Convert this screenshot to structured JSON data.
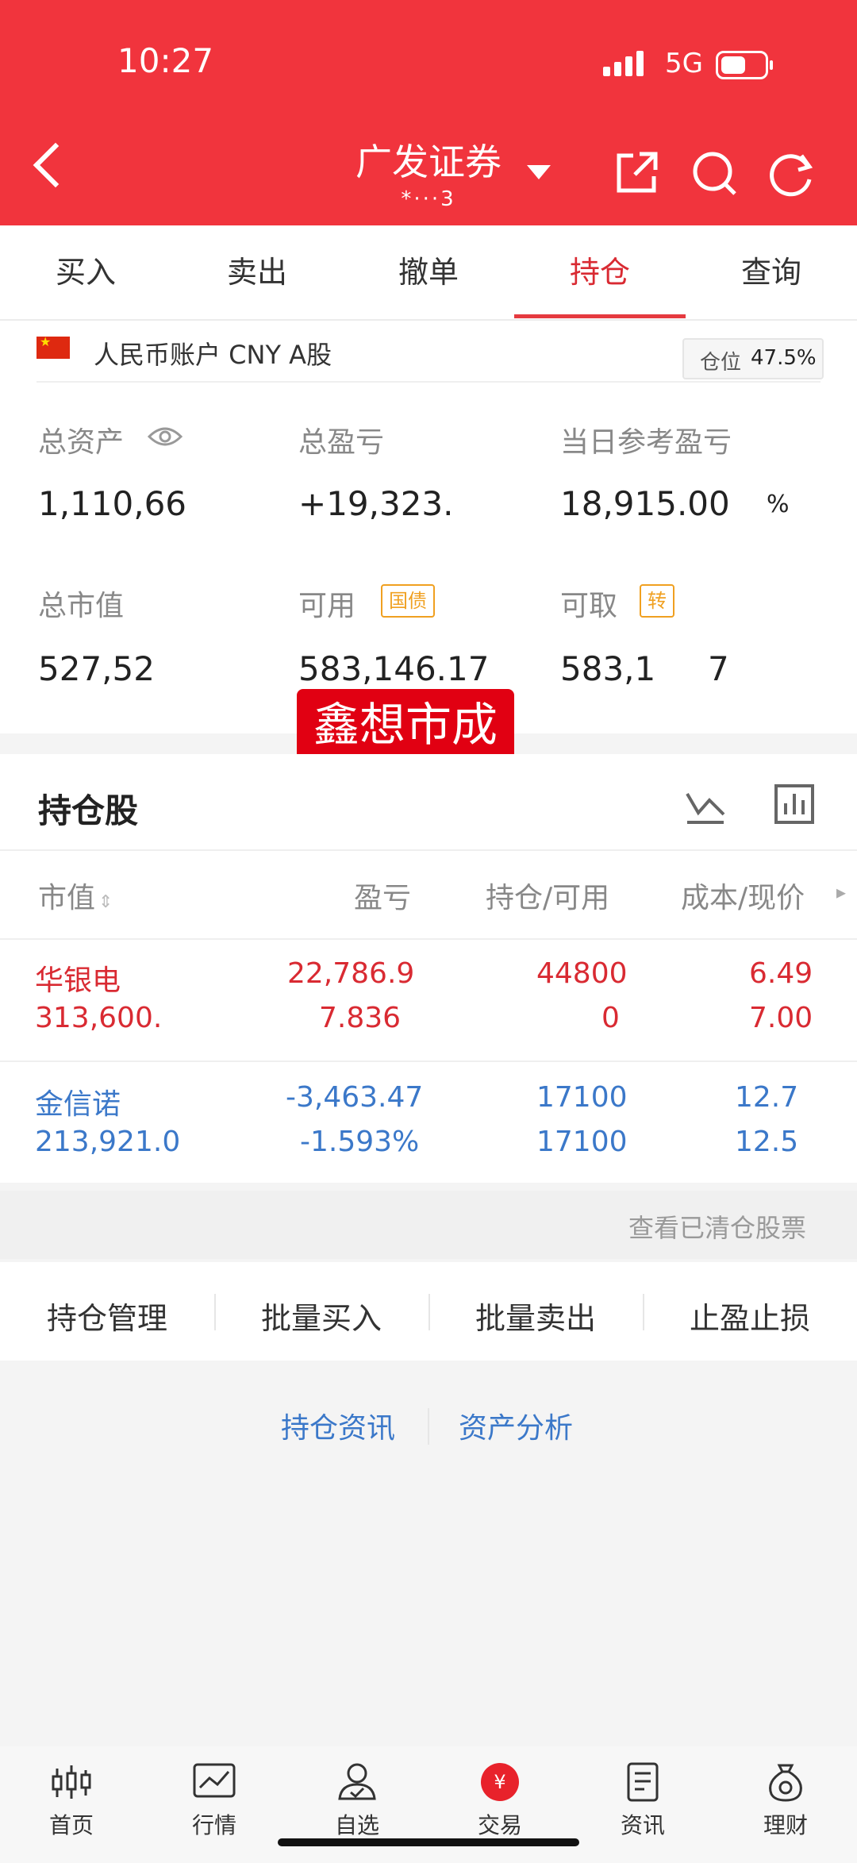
{
  "status_bar": {
    "time": "10:27",
    "network": "5G"
  },
  "header": {
    "account_name": "广发证券",
    "account_sub": "*···3"
  },
  "tabs": [
    {
      "label": "买入"
    },
    {
      "label": "卖出"
    },
    {
      "label": "撤单"
    },
    {
      "label": "持仓",
      "active": true
    },
    {
      "label": "查询"
    }
  ],
  "account": {
    "type_label": "人民币账户 CNY A股",
    "position_label": "仓位",
    "position_value": "47.5%",
    "position_ratio": 0.475
  },
  "metrics": {
    "total_assets_label": "总资产",
    "total_assets_value": "1,110,66",
    "total_pl_label": "总盈亏",
    "total_pl_value": "+19,323.",
    "daily_pl_label": "当日参考盈亏",
    "daily_pl_value": "18,915.00",
    "daily_pl_pct": "%",
    "market_value_label": "总市值",
    "market_value_value": "527,52",
    "available_label": "可用",
    "available_chip": "国债",
    "available_value": "583,146.17",
    "withdrawable_label": "可取",
    "withdrawable_chip": "转",
    "withdrawable_value": "583,1",
    "withdrawable_tail": "7"
  },
  "watermark": "鑫想市成",
  "holdings": {
    "title": "持仓股",
    "columns": [
      "市值",
      "盈亏",
      "持仓/可用",
      "成本/现价"
    ],
    "rows": [
      {
        "name": "华银电",
        "market_value": "313,600.",
        "pl": "22,786.9",
        "pl_pct": "7.836",
        "position": "44800",
        "available": "0",
        "cost": "6.49",
        "price": "7.00",
        "color": "#d92a32"
      },
      {
        "name": "金信诺",
        "market_value": "213,921.0",
        "pl": "-3,463.47",
        "pl_pct": "-1.593%",
        "position": "17100",
        "available": "17100",
        "cost": "12.7",
        "price": "12.5",
        "color": "#3b78c9"
      }
    ]
  },
  "cleared_link": "查看已清仓股票",
  "actions": [
    "持仓管理",
    "批量买入",
    "批量卖出",
    "止盈止损"
  ],
  "links": [
    "持仓资讯",
    "资产分析"
  ],
  "bottom_nav": [
    {
      "label": "首页",
      "icon": "candlestick-icon"
    },
    {
      "label": "行情",
      "icon": "line-chart-icon"
    },
    {
      "label": "自选",
      "icon": "user-check-icon"
    },
    {
      "label": "交易",
      "icon": "yuan-icon",
      "active": true
    },
    {
      "label": "资讯",
      "icon": "document-icon"
    },
    {
      "label": "理财",
      "icon": "money-bag-icon"
    }
  ],
  "colors": {
    "header_red": "#f1343d",
    "up_red": "#d92a32",
    "down_blue": "#3b78c9"
  }
}
